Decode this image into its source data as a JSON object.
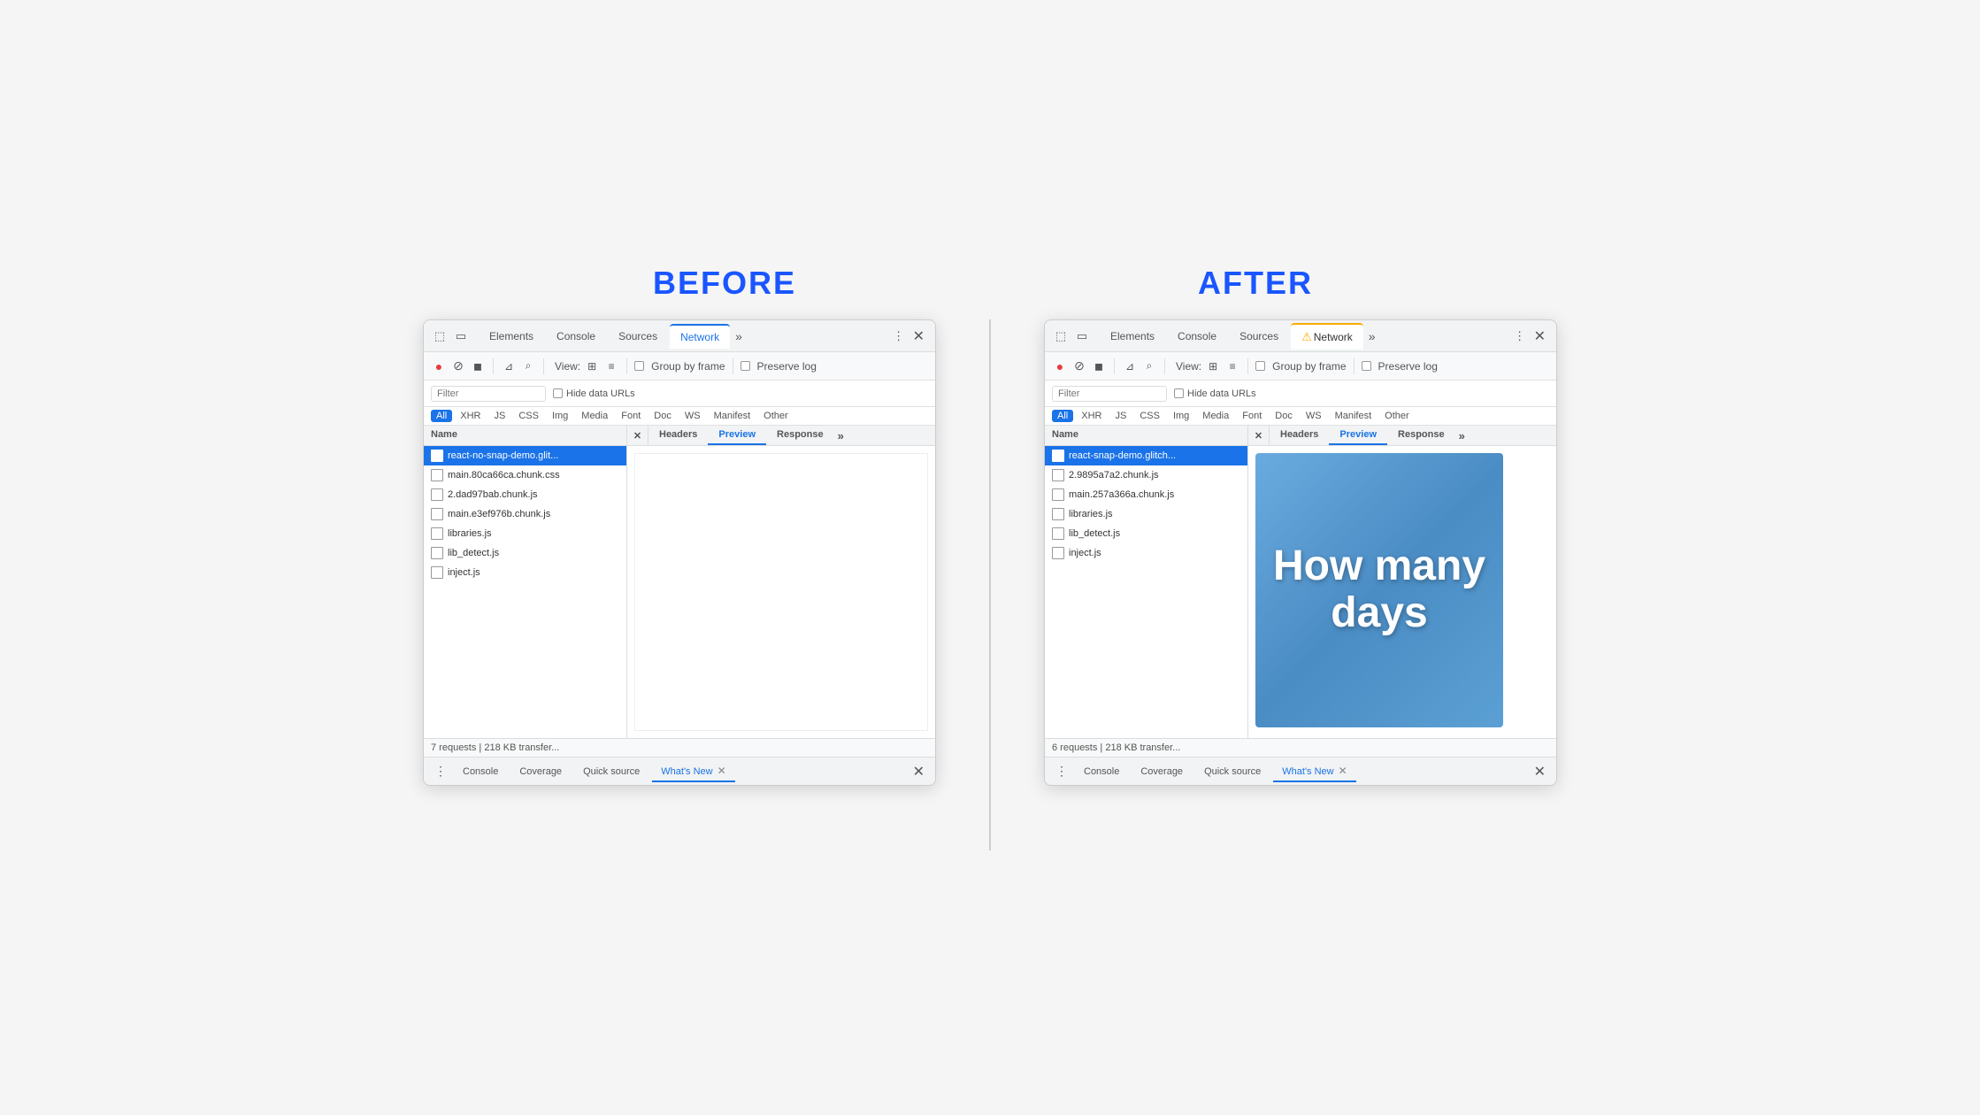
{
  "before": {
    "label": "BEFORE",
    "tabs": [
      "Elements",
      "Console",
      "Sources",
      "Network",
      ">>"
    ],
    "active_tab": "Network",
    "toolbar": {
      "record": "●",
      "no": "🚫",
      "video": "⬛",
      "filter": "⊼",
      "search": "🔍",
      "view_label": "View:",
      "group_by_frame": "Group by frame",
      "preserve_log": "Preserve log"
    },
    "filter_placeholder": "Filter",
    "hide_data_urls": "Hide data URLs",
    "type_filters": [
      "All",
      "XHR",
      "JS",
      "CSS",
      "Img",
      "Media",
      "Font",
      "Doc",
      "WS",
      "Manifest",
      "Other"
    ],
    "active_type": "All",
    "columns": {
      "name": "Name",
      "headers": "Headers",
      "preview": "Preview",
      "response": "Response"
    },
    "active_detail_tab": "Preview",
    "files": [
      {
        "name": "react-no-snap-demo.glit...",
        "selected": true
      },
      {
        "name": "main.80ca66ca.chunk.css",
        "selected": false
      },
      {
        "name": "2.dad97bab.chunk.js",
        "selected": false
      },
      {
        "name": "main.e3ef976b.chunk.js",
        "selected": false
      },
      {
        "name": "libraries.js",
        "selected": false
      },
      {
        "name": "lib_detect.js",
        "selected": false
      },
      {
        "name": "inject.js",
        "selected": false
      }
    ],
    "preview_type": "blank",
    "status": "7 requests | 218 KB transfer...",
    "bottom_tabs": [
      "Console",
      "Coverage",
      "Quick source",
      "What's New"
    ],
    "active_bottom_tab": "What's New"
  },
  "after": {
    "label": "AFTER",
    "tabs": [
      "Elements",
      "Console",
      "Sources",
      "Network",
      ">>"
    ],
    "active_tab": "Network",
    "active_tab_has_warning": true,
    "toolbar": {
      "record": "●",
      "no": "🚫",
      "video": "⬛",
      "filter": "⊼",
      "search": "🔍",
      "view_label": "View:",
      "group_by_frame": "Group by frame",
      "preserve_log": "Preserve log"
    },
    "filter_placeholder": "Filter",
    "hide_data_urls": "Hide data URLs",
    "type_filters": [
      "All",
      "XHR",
      "JS",
      "CSS",
      "Img",
      "Media",
      "Font",
      "Doc",
      "WS",
      "Manifest",
      "Other"
    ],
    "active_type": "All",
    "columns": {
      "name": "Name",
      "headers": "Headers",
      "preview": "Preview",
      "response": "Response"
    },
    "active_detail_tab": "Preview",
    "files": [
      {
        "name": "react-snap-demo.glitch...",
        "selected": true
      },
      {
        "name": "2.9895a7a2.chunk.js",
        "selected": false
      },
      {
        "name": "main.257a366a.chunk.js",
        "selected": false
      },
      {
        "name": "libraries.js",
        "selected": false
      },
      {
        "name": "lib_detect.js",
        "selected": false
      },
      {
        "name": "inject.js",
        "selected": false
      }
    ],
    "preview_type": "image",
    "preview_text": "How\nmany\ndays",
    "status": "6 requests | 218 KB transfer...",
    "bottom_tabs": [
      "Console",
      "Coverage",
      "Quick source",
      "What's New"
    ],
    "active_bottom_tab": "What's New"
  },
  "icons": {
    "cursor": "⬚",
    "mobile": "📱",
    "more": "⋮",
    "close": "✕",
    "record": "●",
    "no_entry": "⊘",
    "camera": "▶",
    "funnel": "⊿",
    "magnify": "⌕",
    "grid": "⊞",
    "list": "≡",
    "warning": "⚠"
  }
}
